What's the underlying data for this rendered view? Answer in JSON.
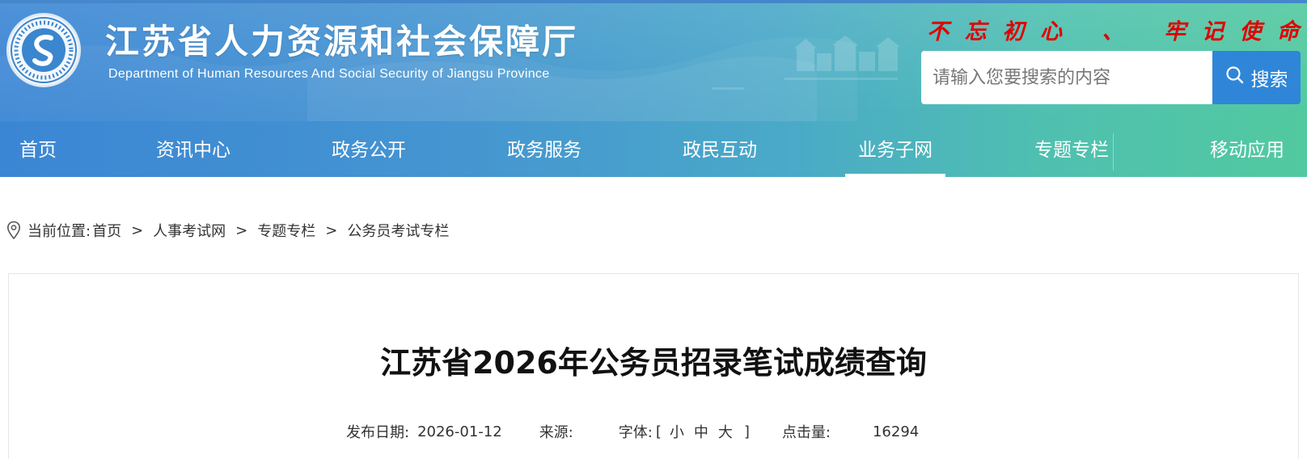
{
  "header": {
    "title": "江苏省人力资源和社会保障厅",
    "subtitle": "Department of Human Resources And Social Security of Jiangsu Province",
    "slogan": [
      "不",
      "忘",
      "初",
      "心",
      "、",
      "牢",
      "记",
      "使",
      "命"
    ],
    "search": {
      "placeholder": "请输入您要搜索的内容",
      "button_label": "搜索"
    }
  },
  "nav": {
    "items": [
      {
        "label": "首页"
      },
      {
        "label": "资讯中心"
      },
      {
        "label": "政务公开"
      },
      {
        "label": "政务服务"
      },
      {
        "label": "政民互动"
      },
      {
        "label": "业务子网",
        "active": true
      },
      {
        "label": "专题专栏"
      },
      {
        "label": "移动应用"
      }
    ]
  },
  "breadcrumb": {
    "prefix": "当前位置:",
    "items": [
      "首页",
      "人事考试网",
      "专题专栏",
      "公务员考试专栏"
    ],
    "separator": ">"
  },
  "article": {
    "title": "江苏省2026年公务员招录笔试成绩查询",
    "meta": {
      "date_label": "发布日期:",
      "date": "2026-01-12",
      "source_label": "来源:",
      "source": "",
      "font_label": "字体:",
      "font_open": "[",
      "font_small": "小",
      "font_medium": "中",
      "font_large": "大",
      "font_close": "]",
      "clicks_label": "点击量:",
      "clicks": "16294"
    }
  },
  "colors": {
    "header_start": "#3b86d4",
    "header_end": "#52c99f",
    "search_button": "#2f86d8",
    "slogan": "#e00000"
  },
  "icons": {
    "logo": "hrss-emblem-icon",
    "search": "search-icon",
    "location": "location-pin-icon"
  }
}
